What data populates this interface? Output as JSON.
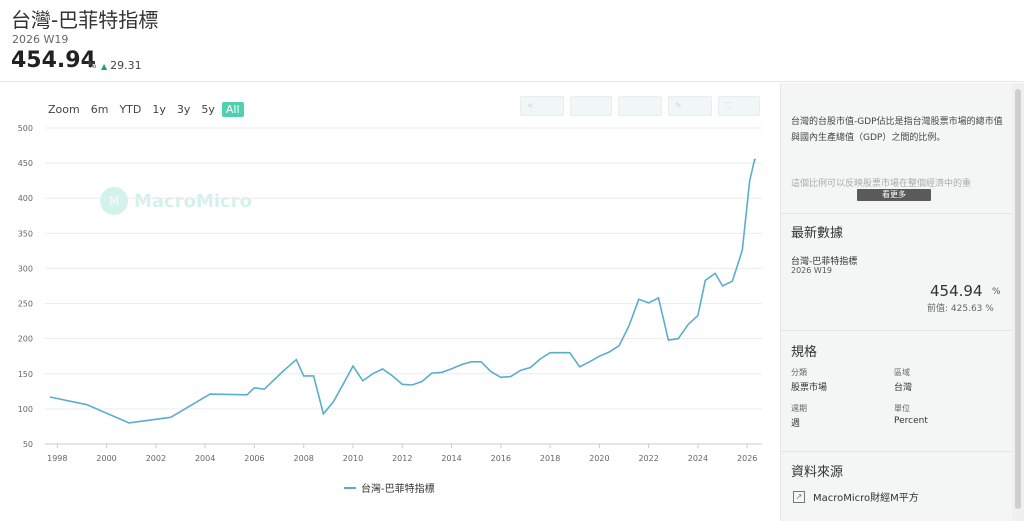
{
  "header": {
    "title": "台灣-巴菲特指標",
    "period": "2026 W19",
    "latest_value": "454.94",
    "latest_unit": "%",
    "change": "29.31"
  },
  "range_buttons": [
    "Zoom",
    "6m",
    "YTD",
    "1y",
    "3y",
    "5y",
    "All"
  ],
  "active_range": "All",
  "watermark": "MacroMicro",
  "legend": "台灣-巴菲特指標",
  "sidebar": {
    "description": "台灣的台股市值-GDP佔比是指台灣股票市場的總市值與國內生產總值（GDP）之間的比例。",
    "description_more": "這個比例可以反映股票市場在整個經濟中的重",
    "more_button": "看更多",
    "latest_title": "最新數據",
    "latest_name": "台灣-巴菲特指標",
    "latest_period": "2026 W19",
    "latest_value": "454.94",
    "latest_unit": "%",
    "prev_label": "前值:",
    "prev_value": "425.63",
    "prev_unit": "%",
    "spec_title": "規格",
    "spec": {
      "category_label": "分類",
      "category": "股票市場",
      "region_label": "區域",
      "region": "台灣",
      "freq_label": "週期",
      "freq": "週",
      "unit_label": "單位",
      "unit": "Percent"
    },
    "source_title": "資料來源",
    "source": "MacroMicro財經M平方"
  },
  "colors": {
    "line": "#5aaecb",
    "accent": "#4fd1b0",
    "up": "#1aa37a"
  },
  "chart_data": {
    "type": "line",
    "title": "",
    "xlabel": "",
    "ylabel": "",
    "ylim": [
      50,
      500
    ],
    "xlim": [
      1997.5,
      2026.6
    ],
    "yticks": [
      50,
      100,
      150,
      200,
      250,
      300,
      350,
      400,
      450,
      500
    ],
    "xticks": [
      1998,
      2000,
      2002,
      2004,
      2006,
      2008,
      2010,
      2012,
      2014,
      2016,
      2018,
      2020,
      2022,
      2024,
      2026
    ],
    "grid": true,
    "legend_position": "bottom",
    "series": [
      {
        "name": "台灣-巴菲特指標",
        "x": [
          1997.7,
          1999.2,
          2000.9,
          2002.6,
          2004.2,
          2005.7,
          2006.0,
          2006.4,
          2007.2,
          2007.7,
          2008.0,
          2008.4,
          2008.8,
          2009.2,
          2009.6,
          2010.0,
          2010.4,
          2010.8,
          2011.2,
          2011.6,
          2012.0,
          2012.4,
          2012.8,
          2013.2,
          2013.6,
          2014.0,
          2014.4,
          2014.8,
          2015.2,
          2015.6,
          2016.0,
          2016.4,
          2016.8,
          2017.2,
          2017.6,
          2018.0,
          2018.4,
          2018.8,
          2019.2,
          2019.6,
          2020.0,
          2020.4,
          2020.8,
          2021.2,
          2021.6,
          2022.0,
          2022.4,
          2022.8,
          2023.2,
          2023.6,
          2024.0,
          2024.3,
          2024.7,
          2025.0,
          2025.4,
          2025.8,
          2026.1,
          2026.3,
          2026.35
        ],
        "values": [
          117,
          106,
          80,
          88,
          121,
          120,
          130,
          128,
          155,
          170,
          147,
          147,
          93,
          110,
          135,
          161,
          140,
          150,
          157,
          147,
          135,
          134,
          139,
          151,
          152,
          157,
          163,
          167,
          167,
          153,
          145,
          146,
          155,
          159,
          171,
          180,
          180,
          180,
          160,
          167,
          175,
          181,
          190,
          218,
          256,
          251,
          258,
          198,
          200,
          220,
          233,
          283,
          293,
          275,
          282,
          326,
          425,
          455,
          455
        ]
      }
    ]
  }
}
